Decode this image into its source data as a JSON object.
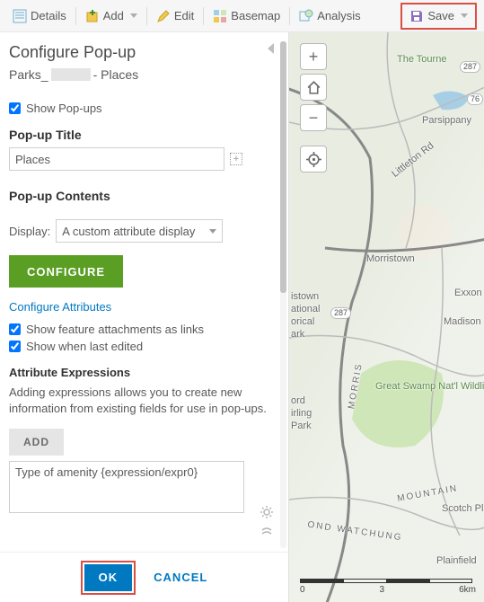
{
  "toolbar": {
    "details": "Details",
    "add": "Add",
    "edit": "Edit",
    "basemap": "Basemap",
    "analysis": "Analysis",
    "save": "Save"
  },
  "panel": {
    "title": "Configure Pop-up",
    "layer_prefix": "Parks_",
    "layer_suffix": " - Places",
    "show_popups": "Show Pop-ups",
    "popup_title_label": "Pop-up Title",
    "popup_title_value": "Places",
    "contents_label": "Pop-up Contents",
    "display_label": "Display:",
    "display_value": "A custom attribute display",
    "configure_btn": "CONFIGURE",
    "config_attrs": "Configure Attributes",
    "show_attachments": "Show feature attachments as links",
    "show_edited": "Show when last edited",
    "expr_head": "Attribute Expressions",
    "expr_desc": "Adding expressions allows you to create new information from existing fields for use in pop-ups.",
    "add_btn": "ADD",
    "expr_item": "Type of amenity {expression/expr0}",
    "ok": "OK",
    "cancel": "CANCEL"
  },
  "map": {
    "labels": {
      "tourne": "The Tourne",
      "parsippany": "Parsippany",
      "littleton": "Littleton Rd",
      "morristown": "Morristown",
      "exxon": "Exxon",
      "madison": "Madison",
      "istown": "istown",
      "ational": "ational",
      "orical": "orical",
      "ark": "ark",
      "swamp": "Great Swamp Nat'l Wildlife Ref",
      "ord": "ord",
      "irling": "irling",
      "park2": "Park",
      "morris": "MORRIS",
      "mountain": "MOUNTAIN",
      "watchung": "OND WATCHUNG",
      "scotch": "Scotch Pl",
      "plainfield": "Plainfield"
    },
    "shields": {
      "s287a": "287",
      "s287b": "287",
      "s76": "76"
    },
    "scale": {
      "s0": "0",
      "s1": "3",
      "s2": "6km"
    }
  }
}
